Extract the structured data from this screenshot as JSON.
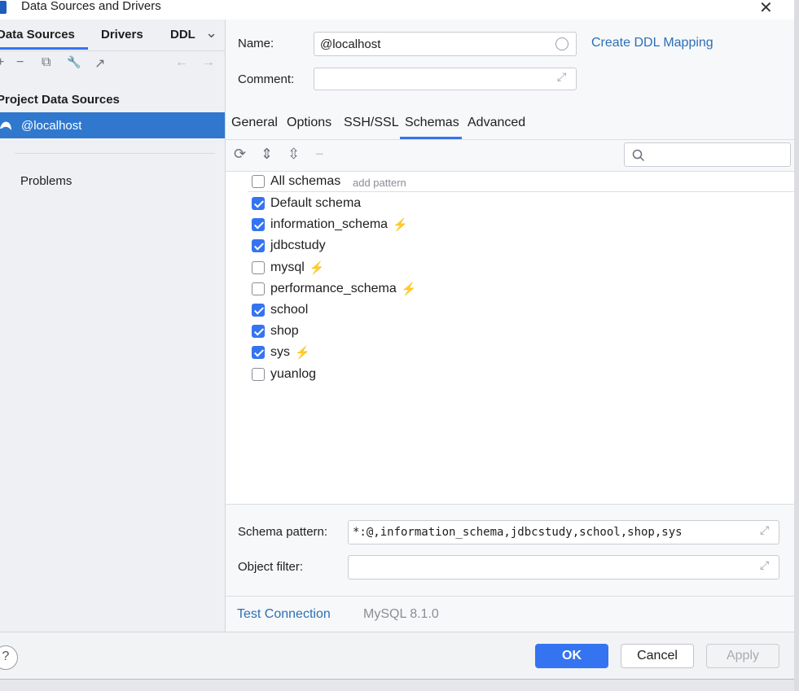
{
  "window": {
    "title": "Data Sources and Drivers",
    "close_glyph": "✕"
  },
  "left": {
    "tabs": [
      "Data Sources",
      "Drivers",
      "DDL"
    ],
    "overflow_glyph": "⌄",
    "toolbar_glyphs": {
      "add": "+",
      "remove": "−",
      "duplicate": "⧉",
      "wrench": "🔧",
      "export": "↗",
      "back": "←",
      "forward": "→"
    },
    "section_header": "Project Data Sources",
    "selected_item": "@localhost",
    "problems_label": "Problems"
  },
  "form": {
    "name_label": "Name:",
    "name_value": "@localhost",
    "create_ddl_link": "Create DDL Mapping",
    "comment_label": "Comment:",
    "comment_value": ""
  },
  "tabs": [
    "General",
    "Options",
    "SSH/SSL",
    "Schemas",
    "Advanced"
  ],
  "active_tab": "Schemas",
  "schema_toolbar": {
    "refresh": "⟳",
    "expand": "⇕",
    "collapse": "⇳",
    "minus": "−"
  },
  "schemas": {
    "all_label": "All schemas",
    "add_pattern_label": "add pattern",
    "items": [
      {
        "name": "Default schema",
        "checked": true,
        "bolt": ""
      },
      {
        "name": "information_schema",
        "checked": true,
        "bolt": "gray"
      },
      {
        "name": "jdbcstudy",
        "checked": true,
        "bolt": ""
      },
      {
        "name": "mysql",
        "checked": false,
        "bolt": "orange"
      },
      {
        "name": "performance_schema",
        "checked": false,
        "bolt": "orange"
      },
      {
        "name": "school",
        "checked": true,
        "bolt": ""
      },
      {
        "name": "shop",
        "checked": true,
        "bolt": ""
      },
      {
        "name": "sys",
        "checked": true,
        "bolt": "gray"
      },
      {
        "name": "yuanlog",
        "checked": false,
        "bolt": ""
      }
    ]
  },
  "pattern": {
    "schema_label": "Schema pattern:",
    "schema_value": "*:@,information_schema,jdbcstudy,school,shop,sys",
    "object_filter_label": "Object filter:",
    "object_filter_value": ""
  },
  "status": {
    "test_connection": "Test Connection",
    "driver_version": "MySQL 8.1.0"
  },
  "buttons": {
    "help": "?",
    "ok": "OK",
    "cancel": "Cancel",
    "apply": "Apply"
  },
  "colors": {
    "accent": "#3574f0",
    "selection": "#2f78ce",
    "link": "#2d6fb5",
    "bolt_orange": "#f0a30a",
    "bolt_gray": "#b8bbc2"
  }
}
